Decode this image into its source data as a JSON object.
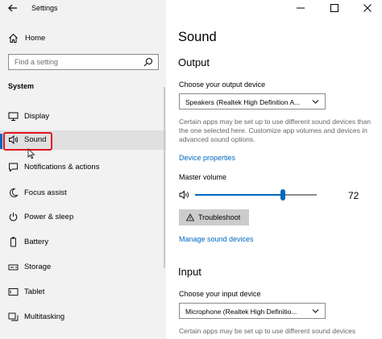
{
  "app": {
    "title": "Settings"
  },
  "sidebar": {
    "home_label": "Home",
    "search_placeholder": "Find a setting",
    "section_label": "System",
    "items": [
      {
        "label": "Display",
        "icon": "display-icon"
      },
      {
        "label": "Sound",
        "icon": "speaker-icon",
        "selected": true
      },
      {
        "label": "Notifications & actions",
        "icon": "notifications-icon"
      },
      {
        "label": "Focus assist",
        "icon": "moon-icon"
      },
      {
        "label": "Power & sleep",
        "icon": "power-icon"
      },
      {
        "label": "Battery",
        "icon": "battery-icon"
      },
      {
        "label": "Storage",
        "icon": "storage-icon"
      },
      {
        "label": "Tablet",
        "icon": "tablet-icon"
      },
      {
        "label": "Multitasking",
        "icon": "multitasking-icon"
      }
    ]
  },
  "main": {
    "page_title": "Sound",
    "output": {
      "heading": "Output",
      "device_label": "Choose your output device",
      "device_value": "Speakers (Realtek High Definition A...",
      "help_text": "Certain apps may be set up to use different sound devices than the one selected here. Customize app volumes and devices in advanced sound options.",
      "device_properties_link": "Device properties",
      "master_volume_label": "Master volume",
      "volume_value": "72",
      "volume_level": 72,
      "troubleshoot_label": "Troubleshoot",
      "manage_devices_link": "Manage sound devices"
    },
    "input": {
      "heading": "Input",
      "device_label": "Choose your input device",
      "device_value": "Microphone (Realtek High Definitio...",
      "help_text": "Certain apps may be set up to use different sound devices"
    }
  },
  "colors": {
    "accent": "#0067c0",
    "highlight_box": "#e3141e",
    "sidebar_bg": "#f2f2f2"
  }
}
